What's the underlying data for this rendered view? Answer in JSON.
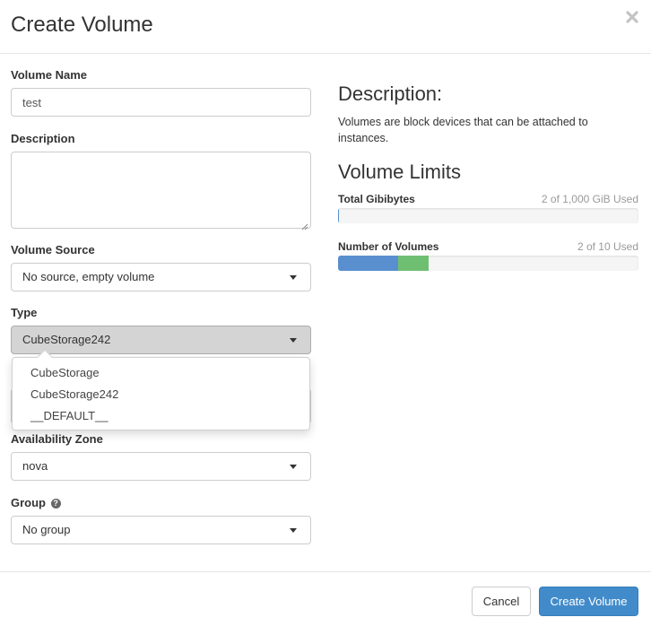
{
  "modal": {
    "title": "Create Volume",
    "close_icon": "close-icon"
  },
  "form": {
    "volume_name": {
      "label": "Volume Name",
      "value": "test"
    },
    "description": {
      "label": "Description",
      "value": ""
    },
    "volume_source": {
      "label": "Volume Source",
      "selected": "No source, empty volume"
    },
    "type": {
      "label": "Type",
      "selected": "CubeStorage242",
      "options": [
        "CubeStorage",
        "CubeStorage242",
        "__DEFAULT__"
      ]
    },
    "availability_zone": {
      "label": "Availability Zone",
      "selected": "nova"
    },
    "group": {
      "label": "Group",
      "help_icon": "question-circle-icon",
      "selected": "No group"
    }
  },
  "description_panel": {
    "title": "Description:",
    "text": "Volumes are block devices that can be attached to instances."
  },
  "limits": {
    "title": "Volume Limits",
    "items": [
      {
        "label": "Total Gibibytes",
        "used_text": "2 of 1,000 GiB Used",
        "used_fraction": 0.002,
        "new_fraction": 0.0
      },
      {
        "label": "Number of Volumes",
        "used_text": "2 of 10 Used",
        "used_fraction": 0.2,
        "new_fraction": 0.1
      }
    ],
    "colors": {
      "used": "#5a8fcf",
      "new": "#6fbf73",
      "track": "#f5f5f5"
    }
  },
  "footer": {
    "cancel_label": "Cancel",
    "submit_label": "Create Volume"
  },
  "colors": {
    "primary": "#428bca"
  }
}
